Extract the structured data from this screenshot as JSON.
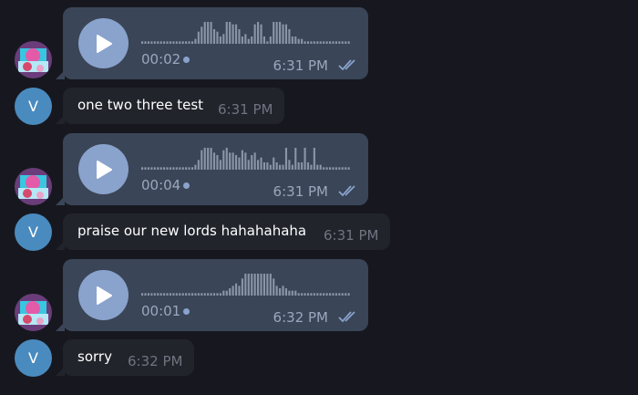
{
  "messages": [
    {
      "kind": "voice",
      "duration": "00:02",
      "time": "6:31 PM",
      "status_icon": "double-check-icon"
    },
    {
      "kind": "text",
      "sender_initial": "V",
      "text": "one two three test",
      "time": "6:31 PM"
    },
    {
      "kind": "voice",
      "duration": "00:04",
      "time": "6:31 PM",
      "status_icon": "double-check-icon"
    },
    {
      "kind": "text",
      "sender_initial": "V",
      "text": "praise our new lords hahahahaha",
      "time": "6:31 PM"
    },
    {
      "kind": "voice",
      "duration": "00:01",
      "time": "6:32 PM",
      "status_icon": "double-check-icon"
    },
    {
      "kind": "text",
      "sender_initial": "V",
      "text": "sorry",
      "time": "6:32 PM"
    }
  ],
  "colors": {
    "background": "#17181f",
    "voice_bubble": "#3a4558",
    "text_bubble": "#22242c",
    "play_button": "#8aa3cc",
    "avatar_v": "#4a8bbf",
    "waveform": "#8a95a8"
  }
}
